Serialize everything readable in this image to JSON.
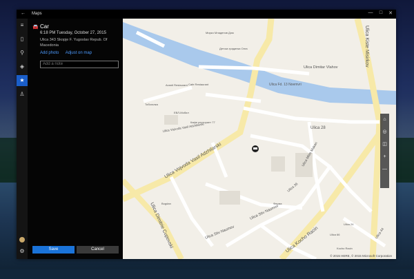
{
  "window": {
    "title": "Maps",
    "back_icon": "back-arrow-icon",
    "minimize": "—",
    "maximize": "□",
    "close": "✕"
  },
  "rail": {
    "items": [
      {
        "icon": "hamburger-icon",
        "glyph": "≡"
      },
      {
        "icon": "map-icon",
        "glyph": "▯"
      },
      {
        "icon": "search-icon",
        "glyph": "⚲"
      },
      {
        "icon": "directions-icon",
        "glyph": "◈"
      },
      {
        "icon": "favorites-star-icon",
        "glyph": "★"
      },
      {
        "icon": "person-icon",
        "glyph": "♙"
      }
    ],
    "bottom": [
      {
        "icon": "avatar-icon"
      },
      {
        "icon": "settings-icon",
        "glyph": "⚙"
      }
    ]
  },
  "panel": {
    "name": "Car",
    "datetime": "6:18 PM Tuesday, October 27, 2015",
    "address": "Ulica 343 Skopje F. Yugoslav Repub. Of Macedonia",
    "add_photo": "Add photo",
    "adjust": "Adjust on map",
    "note_placeholder": "Add a note",
    "save": "Save",
    "cancel": "Cancel"
  },
  "map": {
    "streets": {
      "kiste": "Ulica Kiste Misirkov",
      "dimitar": "Ulica Dimitar Vlahov",
      "vojvoda": "Ulica Vojvoda Vasil Adzhilarski",
      "kocho": "Ulica Kocho Racin",
      "dimitrie": "Ulica Dimitrie Cupovski",
      "stiv": "Ulica Stiv Naumov",
      "s28": "Ulica 28",
      "s36": "Ulica 36",
      "s44": "Ulica 44",
      "mitre": "Ulica Mitre Makan",
      "fd": "Ulica Fd. 13 Noemvri",
      "vojvoda_small": "Ulica Vojvoda Vasil Adzhilarski"
    },
    "pois": {
      "p1": "Мирко Младенов Дом",
      "p2": "Детска градинка Олга",
      "p3": "Cafe Restaurant",
      "p4": "Avanti Restaurant",
      "p5": "Тобогалка",
      "p6": "Кафе ресторант 77",
      "p7": "ЕВЛ-Мобил",
      "p8": "Bogdan",
      "p9": "Ферма",
      "p10": "Ulica 66",
      "p11": "Kocho Racin",
      "p12": "Ulica 24"
    },
    "controls": [
      "car-icon",
      "target-icon",
      "layers-icon",
      "zoom-in-icon",
      "zoom-out-icon"
    ],
    "copyright": "© 2015 HERE, © 2015 Microsoft Corporation"
  }
}
